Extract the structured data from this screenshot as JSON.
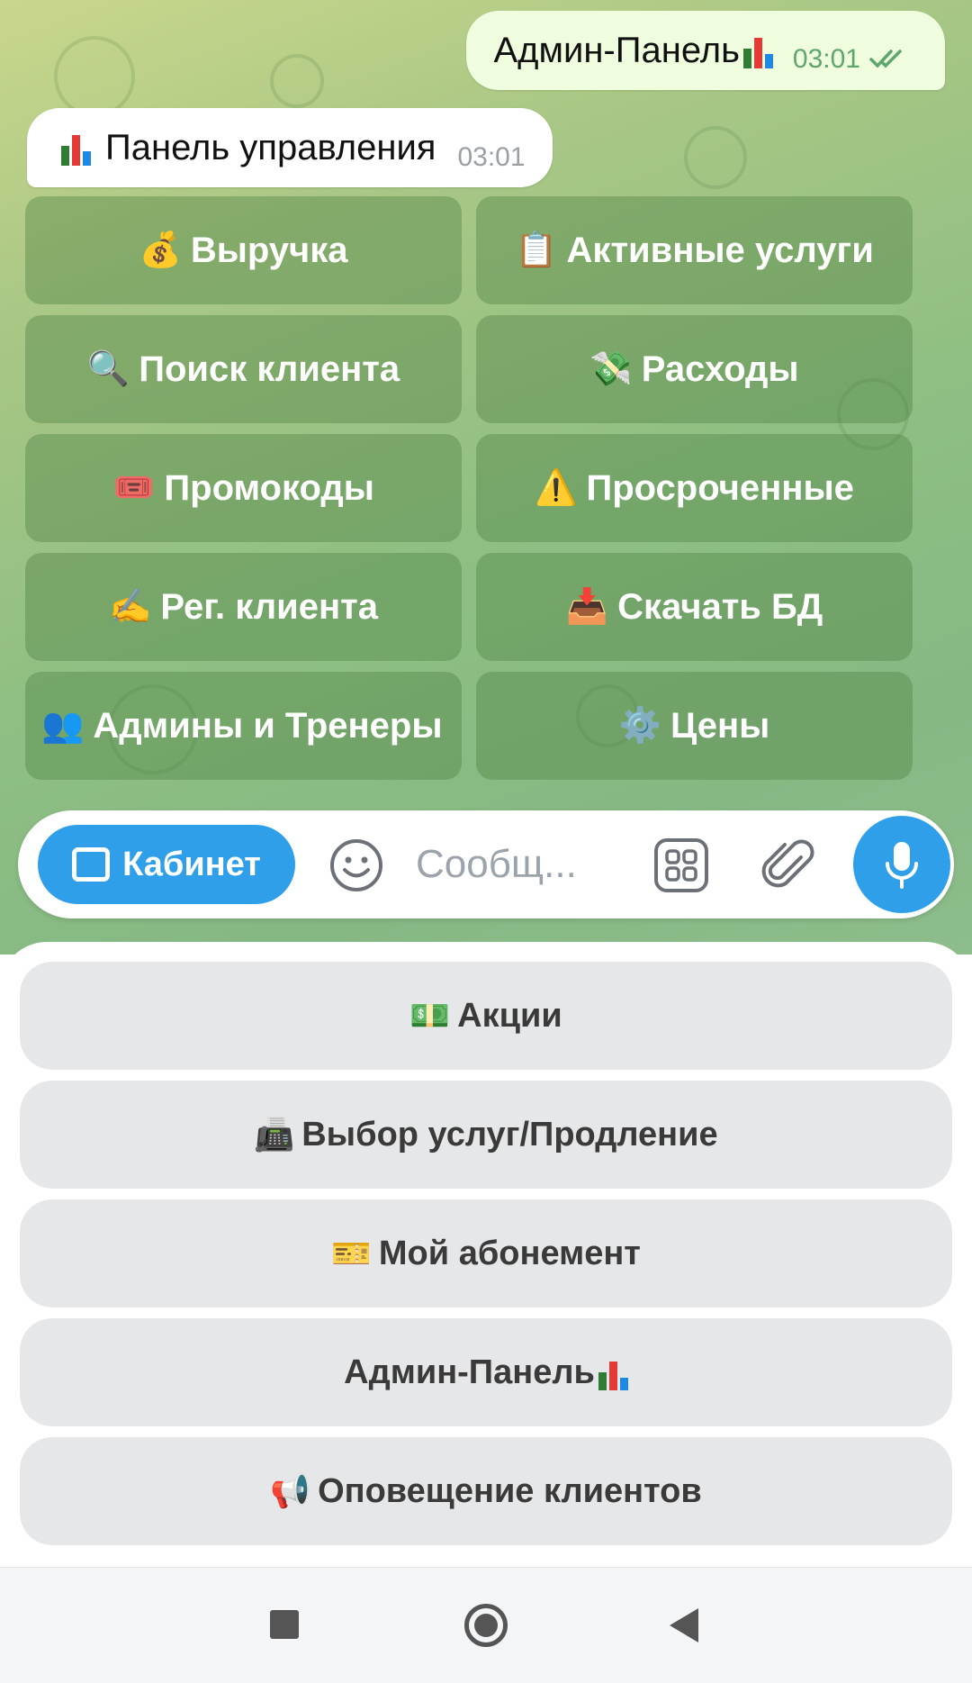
{
  "chat": {
    "outgoing": {
      "text": "Админ-Панель",
      "time": "03:01"
    },
    "incoming": {
      "text": "Панель управления",
      "time": "03:01"
    }
  },
  "inline_keyboard": [
    {
      "emoji": "💰",
      "label": "Выручка"
    },
    {
      "emoji": "📋",
      "label": "Активные услуги"
    },
    {
      "emoji": "🔍",
      "label": "Поиск клиента"
    },
    {
      "emoji": "💸",
      "label": "Расходы"
    },
    {
      "emoji": "🎟️",
      "label": "Промокоды"
    },
    {
      "emoji": "⚠️",
      "label": "Просроченные"
    },
    {
      "emoji": "✍️",
      "label": "Рег. клиента"
    },
    {
      "emoji": "📥",
      "label": "Скачать БД"
    },
    {
      "emoji": "👥",
      "label": "Админы и Тренеры"
    },
    {
      "emoji": "⚙️",
      "label": "Цены"
    }
  ],
  "input_bar": {
    "cabinet_label": "Кабинет",
    "placeholder": "Сообщ..."
  },
  "reply_keyboard": [
    {
      "emoji": "💵",
      "label": "Акции"
    },
    {
      "emoji": "📠",
      "label": "Выбор услуг/Продление"
    },
    {
      "emoji": "🎫",
      "label": "Мой абонемент"
    },
    {
      "emoji": "",
      "label": "Админ-Панель",
      "chart": true
    },
    {
      "emoji": "📢",
      "label": "Оповещение клиентов"
    }
  ],
  "colors": {
    "accent": "#2f9fea",
    "outgoing_bubble": "#effdde",
    "chart_bars": [
      "#2e7d32",
      "#e53935",
      "#1e88e5"
    ]
  }
}
